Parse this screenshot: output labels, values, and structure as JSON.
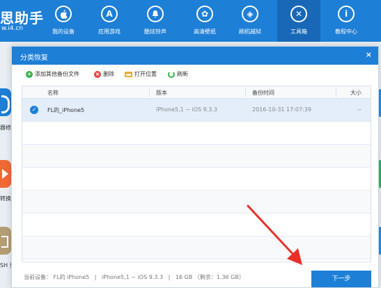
{
  "app": {
    "logo_text": "思助手",
    "logo_url": "w.i4.cn",
    "accent": "#1e7fd6"
  },
  "nav": [
    {
      "label": "我的设备",
      "icon": "apple-icon",
      "glyph": ""
    },
    {
      "label": "应用游戏",
      "icon": "appstore-icon",
      "glyph": "A"
    },
    {
      "label": "酷炫铃声",
      "icon": "bell-icon",
      "glyph": "♪"
    },
    {
      "label": "高清壁纸",
      "icon": "flower-icon",
      "glyph": "✿"
    },
    {
      "label": "刷机越狱",
      "icon": "box-icon",
      "glyph": "◈"
    },
    {
      "label": "工具箱",
      "icon": "tools-icon",
      "glyph": "✕"
    },
    {
      "label": "教程中心",
      "icon": "info-icon",
      "glyph": "i"
    }
  ],
  "sidebar": {
    "frag1": "器修",
    "frag2": "转换",
    "frag3": "SH 登"
  },
  "dialog": {
    "title": "分类恢复",
    "close": "×",
    "toolbar": {
      "add": "添加其他备份文件",
      "delete": "删除",
      "open_location": "打开位置",
      "refresh": "刷新"
    },
    "columns": {
      "name": "名称",
      "version": "版本",
      "backup_time": "备份时间",
      "size": "大小"
    },
    "rows": [
      {
        "name": "FL的_iPhone5",
        "version": "iPhone5,1 ~ iOS 9.3.3",
        "backup_time": "2016-10-31 17:07:39",
        "size": "--",
        "selected": true
      }
    ],
    "footer": {
      "device_label": "当前设备：",
      "device_name": "FL的 iPhone5",
      "sep1": "|",
      "model": "iPhone5,1 ~ iOS 9.3.3",
      "sep2": "|",
      "capacity": "16 GB （剩余：1.36 GB）",
      "next": "下一步"
    }
  },
  "annotation_color": "#e8302a"
}
